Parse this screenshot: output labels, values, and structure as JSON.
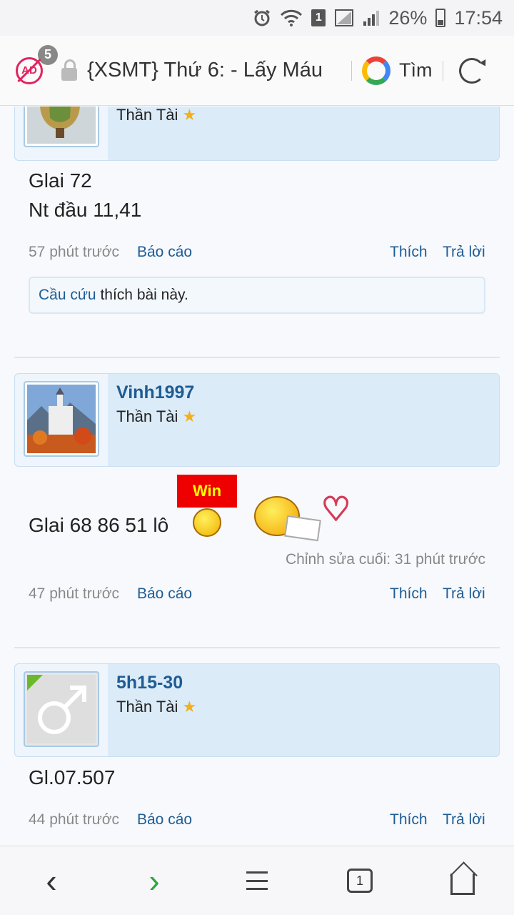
{
  "status_bar": {
    "battery": "26%",
    "time": "17:54",
    "sim": "1"
  },
  "browser": {
    "ad_badge": "5",
    "ad_label": "AD",
    "title": "{XSMT} Thứ 6: - Lấy Máu",
    "search_label": "Tìm"
  },
  "posts": [
    {
      "rank": "Thần Tài",
      "lines": [
        "Glai 72",
        "Nt đầu 11,41"
      ],
      "time": "57 phút trước",
      "report": "Báo cáo",
      "like": "Thích",
      "reply": "Trả lời",
      "liked_by": "Cầu cứu",
      "liked_text": "thích bài này."
    },
    {
      "username": "Vinh1997",
      "rank": "Thần Tài",
      "message": "Glai 68 86 51 lô",
      "win_sign": "Win",
      "edited": "Chỉnh sửa cuối: 31 phút trước",
      "time": "47 phút trước",
      "report": "Báo cáo",
      "like": "Thích",
      "reply": "Trả lời"
    },
    {
      "username": "5h15-30",
      "rank": "Thần Tài",
      "message": "Gl.07.507",
      "time": "44 phút trước",
      "report": "Báo cáo",
      "like": "Thích",
      "reply": "Trả lời"
    }
  ],
  "bottom_nav": {
    "tab_count": "1"
  },
  "colors": {
    "link": "#1e5c94",
    "card": "#dcebf8",
    "forward": "#2ca83a",
    "adblock": "#e0245e"
  }
}
